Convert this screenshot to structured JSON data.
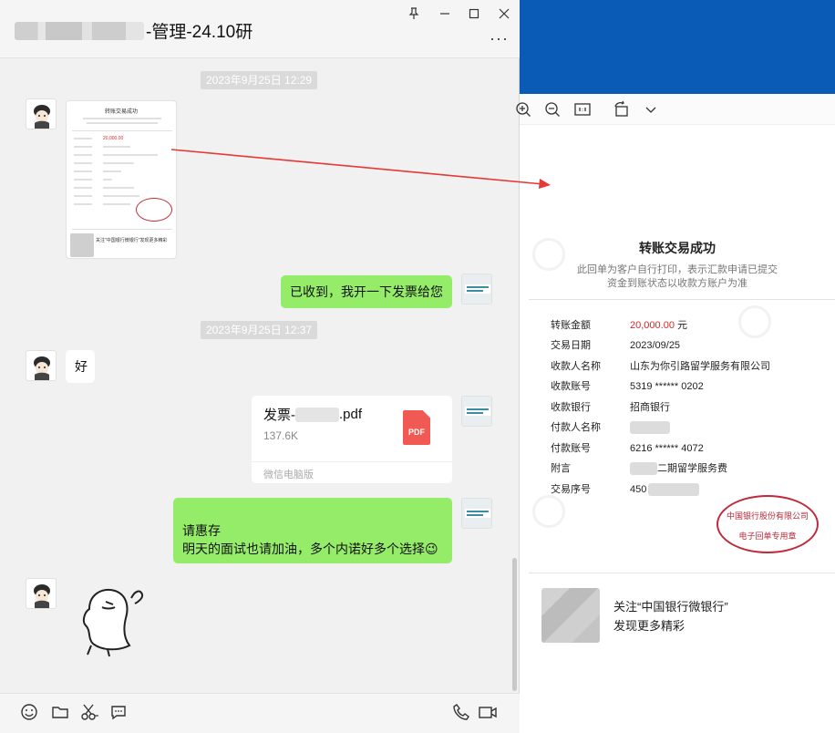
{
  "chat": {
    "title_suffix": "-管理-24.10研",
    "window_controls": {
      "pin": "⊥",
      "minimize": "—",
      "maximize": "☐",
      "close": "✕"
    },
    "more": "···",
    "timestamps": [
      "2023年9月25日 12:29",
      "2023年9月25日 12:37"
    ],
    "messages": {
      "received_ok": "已收到，我开一下发票给您",
      "reply_good": "好",
      "file": {
        "name_prefix": "发票-",
        "name_suffix": ".pdf",
        "size": "137.6K",
        "source": "微信电脑版",
        "badge": "PDF"
      },
      "final_line1": "请惠存",
      "final_line2": "明天的面试也请加油，多个内诺好多个选择",
      "final_emoji": "😉"
    },
    "toolbar": [
      "emoji-icon",
      "folder-icon",
      "scissors-icon",
      "chat-icon",
      "phone-icon",
      "video-icon"
    ]
  },
  "thumbnail": {
    "title": "转账交易成功",
    "amount": "20,000.00",
    "promo": "关注\"中国银行微银行\"发现更多精彩"
  },
  "viewer": {
    "toolbar": [
      "zoom-in-icon",
      "zoom-out-icon",
      "actual-size-icon",
      "rotate-icon",
      "chevron-down-icon"
    ],
    "receipt": {
      "title": "转账交易成功",
      "note_line1": "此回单为客户自行打印，表示汇款申请已提交",
      "note_line2": "资金到账状态以收款方账户为准",
      "rows": [
        {
          "label": "转账金额",
          "value": "20,000.00",
          "unit": "元"
        },
        {
          "label": "交易日期",
          "value": "2023/09/25"
        },
        {
          "label": "收款人名称",
          "value": "山东为你引路留学服务有限公司"
        },
        {
          "label": "收款账号",
          "value": "5319 ****** 0202"
        },
        {
          "label": "收款银行",
          "value": "招商银行"
        },
        {
          "label": "付款人名称",
          "value": ""
        },
        {
          "label": "付款账号",
          "value": "6216 ****** 4072"
        },
        {
          "label": "附言",
          "value": "二期留学服务费"
        },
        {
          "label": "交易序号",
          "value": "450"
        }
      ],
      "seal_top": "中国银行股份有限公司",
      "seal_bottom": "电子回单专用章",
      "promo_line1": "关注“中国银行微银行”",
      "promo_line2": "发现更多精彩"
    }
  },
  "colors": {
    "accent_green": "#95ec69",
    "brand_blue": "#0a5bb5",
    "amount_red": "#d22a2a",
    "seal_red": "#c02b3c"
  }
}
